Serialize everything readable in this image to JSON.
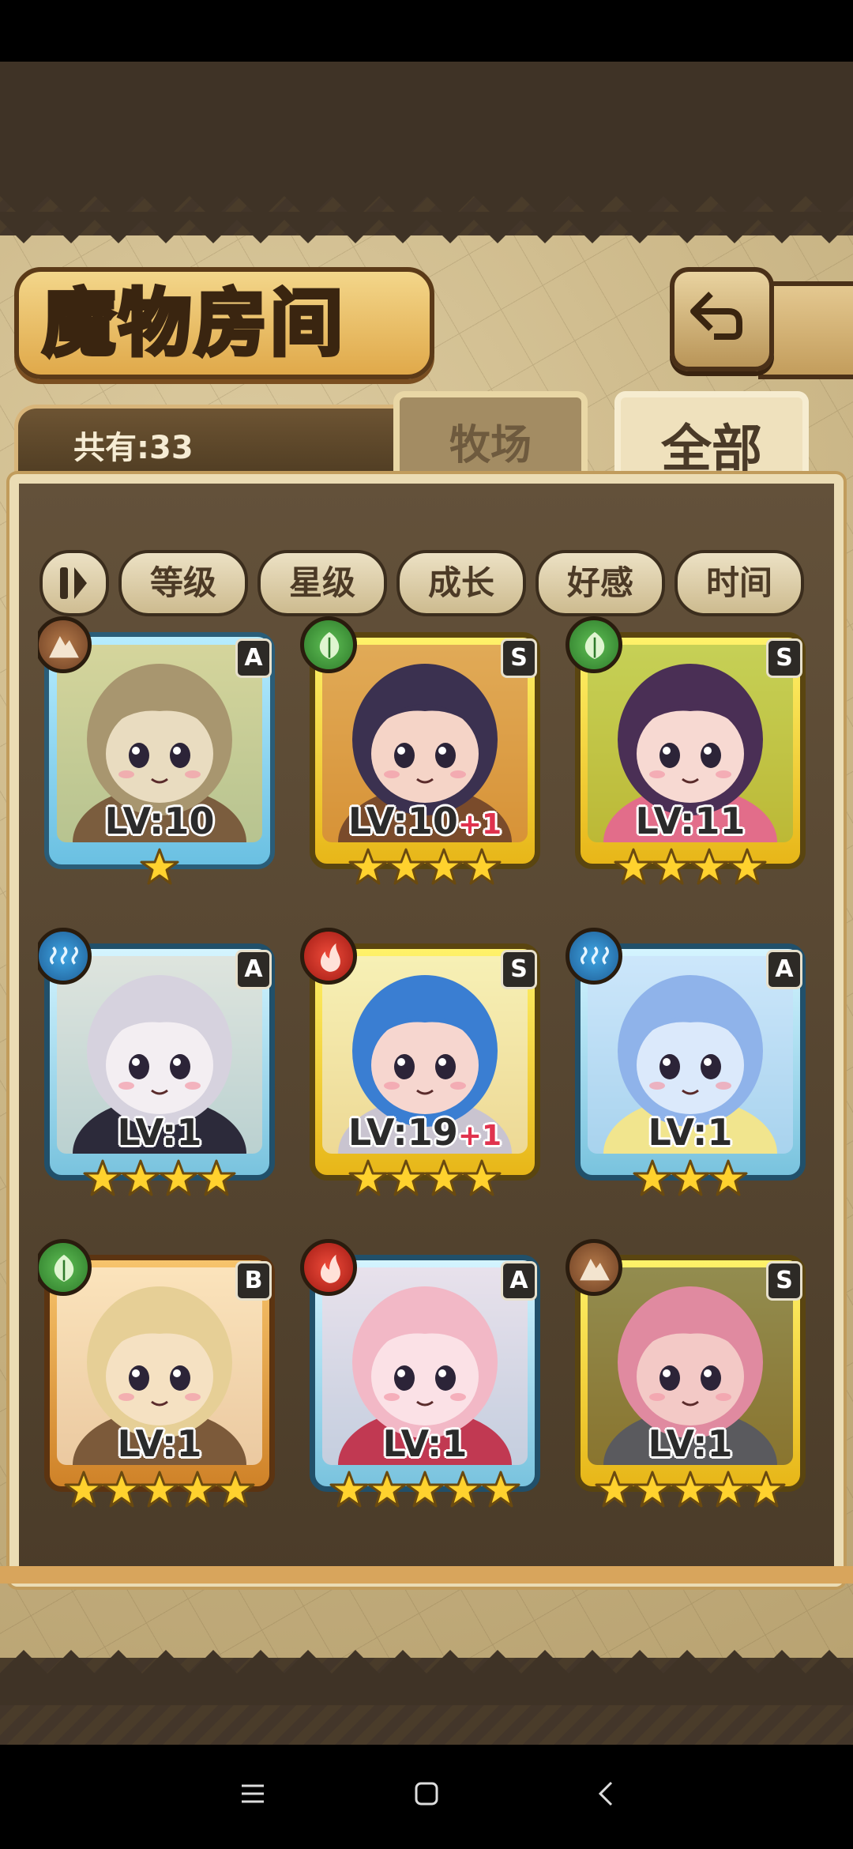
{
  "screen": {
    "title": "魔物房间",
    "count_label": "共有:33",
    "tabs": [
      {
        "label": "牧场",
        "active": false
      },
      {
        "label": "全部",
        "active": true
      }
    ],
    "sort_buttons": [
      "等级",
      "星级",
      "成长",
      "好感",
      "时间"
    ],
    "back_icon": "back-arrow-icon",
    "sort_toggle_icon": "sort-order-icon"
  },
  "monsters": [
    {
      "element": "earth",
      "rank": "A",
      "level": "LV:10",
      "bonus": "",
      "stars": 1,
      "frame": "blue-simple",
      "palette": [
        "#e9dcc0",
        "#a8966f",
        "#f1c24a",
        "#7b5d3e"
      ]
    },
    {
      "element": "wood",
      "rank": "S",
      "level": "LV:10",
      "bonus": "+1",
      "stars": 4,
      "frame": "gold",
      "palette": [
        "#f5d4c7",
        "#3b3150",
        "#c9714b",
        "#7a4b2b"
      ]
    },
    {
      "element": "wood",
      "rank": "S",
      "level": "LV:11",
      "bonus": "",
      "stars": 4,
      "frame": "gold",
      "palette": [
        "#f7d9d2",
        "#4a2f55",
        "#98b648",
        "#e26d8a"
      ]
    },
    {
      "element": "water",
      "rank": "A",
      "level": "LV:1",
      "bonus": "",
      "stars": 4,
      "frame": "blue",
      "palette": [
        "#f3eef2",
        "#d6d2de",
        "#e9d8c3",
        "#2c2a3a"
      ]
    },
    {
      "element": "fire",
      "rank": "S",
      "level": "LV:19",
      "bonus": "+1",
      "stars": 4,
      "frame": "gold",
      "palette": [
        "#f6d6cf",
        "#3a7ed2",
        "#f0f0f6",
        "#c9c4d0"
      ]
    },
    {
      "element": "water",
      "rank": "A",
      "level": "LV:1",
      "bonus": "",
      "stars": 3,
      "frame": "blue",
      "palette": [
        "#dbe9fb",
        "#8fb3ea",
        "#c9dcf7",
        "#f1e58e"
      ]
    },
    {
      "element": "wood",
      "rank": "B",
      "level": "LV:1",
      "bonus": "",
      "stars": 5,
      "frame": "bronze",
      "palette": [
        "#f5e1c2",
        "#e6cf96",
        "#ffffff",
        "#7c5a3a"
      ]
    },
    {
      "element": "fire",
      "rank": "A",
      "level": "LV:1",
      "bonus": "",
      "stars": 5,
      "frame": "blue",
      "palette": [
        "#fbe1e6",
        "#f2b8c6",
        "#fbd3dd",
        "#c13952"
      ]
    },
    {
      "element": "earth",
      "rank": "S",
      "level": "LV:1",
      "bonus": "",
      "stars": 5,
      "frame": "gold",
      "palette": [
        "#f3c9c6",
        "#e08aa0",
        "#3b3a3d",
        "#5a5a5e"
      ]
    }
  ],
  "system_nav": [
    "menu-icon",
    "home-icon",
    "back-icon"
  ]
}
